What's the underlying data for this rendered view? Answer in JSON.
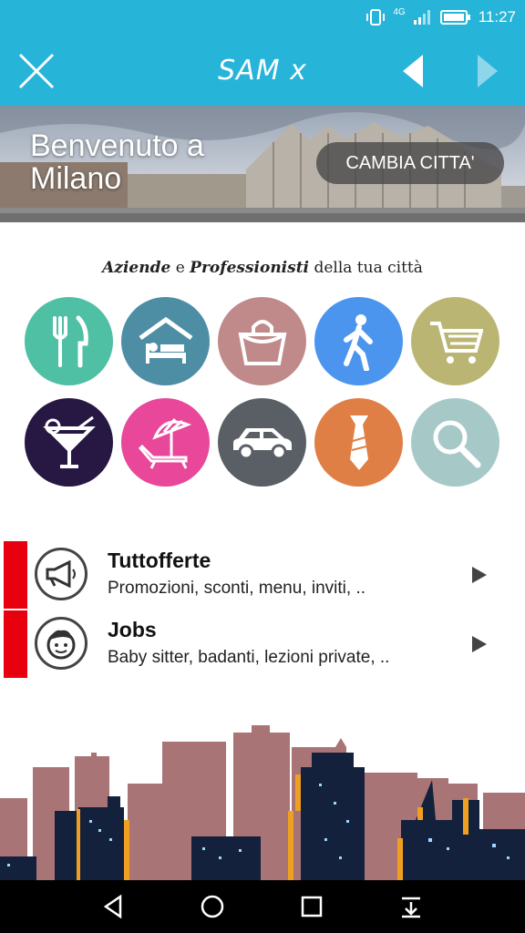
{
  "status": {
    "network": "4G",
    "time": "11:27"
  },
  "appbar": {
    "title": "SAM x"
  },
  "hero": {
    "welcome": "Benvenuto a Milano",
    "change_city": "CAMBIA CITTA'"
  },
  "tagline": {
    "part1": "Aziende",
    "and": "e",
    "part2": "Professionisti",
    "rest": "della tua città"
  },
  "categories": [
    {
      "icon": "cutlery-icon",
      "color": "#4fc0a3"
    },
    {
      "icon": "hotel-bed-icon",
      "color": "#4e8ea5"
    },
    {
      "icon": "shopping-bag-icon",
      "color": "#c08a8b"
    },
    {
      "icon": "walking-person-icon",
      "color": "#4b95ef"
    },
    {
      "icon": "shopping-cart-icon",
      "color": "#bbb574"
    },
    {
      "icon": "cocktail-icon",
      "color": "#261743"
    },
    {
      "icon": "beach-umbrella-icon",
      "color": "#e8479a"
    },
    {
      "icon": "car-icon",
      "color": "#5a5f66"
    },
    {
      "icon": "tie-icon",
      "color": "#e07f45"
    },
    {
      "icon": "search-icon",
      "color": "#a6c9c8"
    }
  ],
  "list": [
    {
      "title": "Tuttofferte",
      "subtitle": "Promozioni, sconti, menu, inviti, ..",
      "icon": "megaphone-icon"
    },
    {
      "title": "Jobs",
      "subtitle": "Baby sitter, badanti, lezioni private, ..",
      "icon": "face-icon"
    }
  ],
  "colors": {
    "primary": "#26b4d9",
    "accent_red": "#e8000e"
  }
}
